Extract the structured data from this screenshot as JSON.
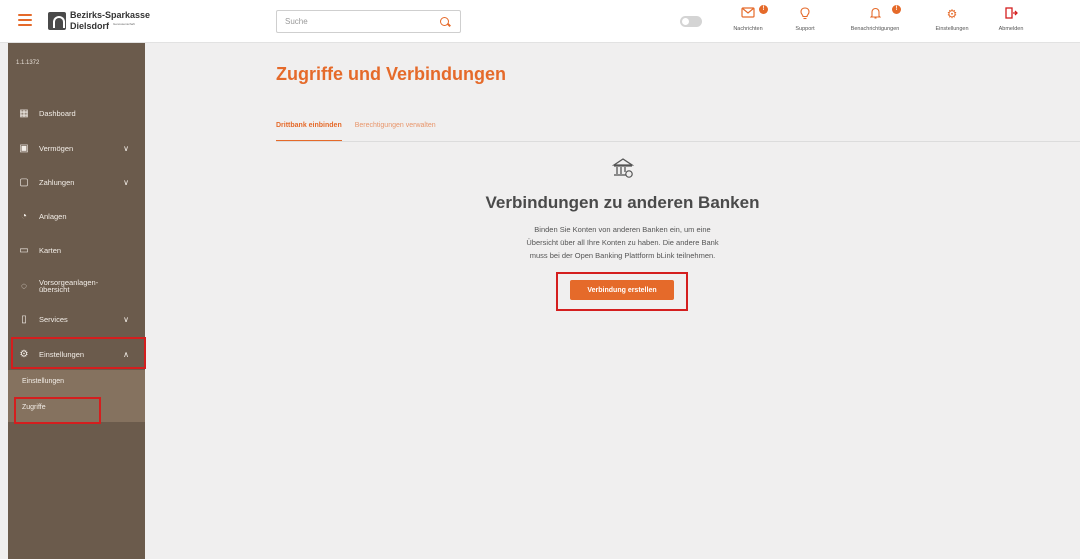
{
  "header": {
    "logo_line1": "Bezirks-Sparkasse",
    "logo_line2": "Dielsdorf",
    "logo_sub": "Genossenschaft",
    "search_placeholder": "Suche",
    "items": [
      {
        "label": "Nachrichten",
        "icon": "mail-icon",
        "badge": "!"
      },
      {
        "label": "Support",
        "icon": "lightbulb-icon"
      },
      {
        "label": "Benachrichtigungen",
        "icon": "bell-icon",
        "badge": "!"
      },
      {
        "label": "Einstellungen",
        "icon": "gear-icon"
      },
      {
        "label": "Abmelden",
        "icon": "logout-icon"
      }
    ]
  },
  "sidebar": {
    "user_id": "1.1.1372",
    "items": [
      {
        "label": "Dashboard",
        "icon": "dashboard-icon"
      },
      {
        "label": "Vermögen",
        "icon": "wallet-icon",
        "chevron": "down"
      },
      {
        "label": "Zahlungen",
        "icon": "payment-icon",
        "chevron": "down"
      },
      {
        "label": "Anlagen",
        "icon": "chart-icon"
      },
      {
        "label": "Karten",
        "icon": "card-icon"
      },
      {
        "label": "Vorsorgeanlagen-übersicht",
        "label_l1": "Vorsorgeanlagen-",
        "label_l2": "übersicht",
        "icon": "piggy-icon"
      },
      {
        "label": "Services",
        "icon": "services-icon",
        "chevron": "down"
      },
      {
        "label": "Einstellungen",
        "icon": "gear-icon",
        "chevron": "up"
      }
    ],
    "subitems": [
      {
        "label": "Einstellungen"
      },
      {
        "label": "Zugriffe"
      }
    ]
  },
  "main": {
    "title": "Zugriffe und Verbindungen",
    "tabs": [
      {
        "label": "Drittbank einbinden",
        "active": true
      },
      {
        "label": "Berechtigungen verwalten",
        "active": false
      }
    ],
    "card": {
      "icon": "bank-icon",
      "title": "Verbindungen zu anderen Banken",
      "text_l1": "Binden Sie Konten von anderen Banken ein, um eine",
      "text_l2": "Übersicht über all Ihre Konten zu haben. Die andere Bank",
      "text_l3": "muss bei der Open Banking Plattform bLink teilnehmen.",
      "button": "Verbindung erstellen"
    }
  },
  "colors": {
    "accent": "#e56a2a",
    "sidebar": "#6b5b4c",
    "sidebar_sub": "#85725f",
    "highlight": "#d41e1e"
  }
}
